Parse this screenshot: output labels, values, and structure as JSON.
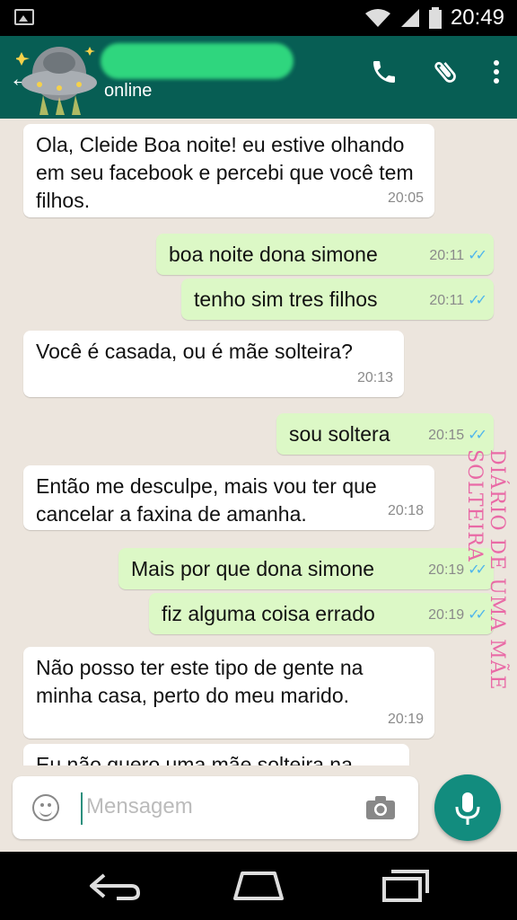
{
  "status_bar": {
    "time": "20:49"
  },
  "header": {
    "status": "online"
  },
  "messages": [
    {
      "text": "Ola, Cleide Boa noite! eu estive olhando em seu facebook e percebi que você  tem filhos.",
      "time": "20:05"
    },
    {
      "text": "boa noite dona simone",
      "time": "20:11"
    },
    {
      "text": "tenho sim tres filhos",
      "time": "20:11"
    },
    {
      "text": "Você é casada, ou é  mãe solteira?",
      "time": "20:13"
    },
    {
      "text": "sou soltera",
      "time": "20:15"
    },
    {
      "text": "Então me desculpe, mais vou ter que cancelar a faxina de amanha.",
      "time": "20:18"
    },
    {
      "text": "Mais por que dona simone",
      "time": "20:19"
    },
    {
      "text": "fiz alguma coisa errado",
      "time": "20:19"
    },
    {
      "text": "Não  posso ter este tipo de gente na minha casa, perto do meu marido.",
      "time": "20:19"
    },
    {
      "text": "Eu não quero uma mãe solteira na",
      "time": ""
    }
  ],
  "watermark": "DIÁRIO DE UMA MÃE SOLTEIRA",
  "input": {
    "placeholder": "Mensagem"
  },
  "icons": {
    "header": [
      "back-arrow-icon",
      "avatar",
      "phone-icon",
      "paperclip-icon",
      "more-vert-icon"
    ],
    "input": [
      "emoji-icon",
      "camera-icon",
      "mic-icon"
    ],
    "nav": [
      "back-nav-icon",
      "home-icon",
      "recents-icon"
    ]
  },
  "colors": {
    "header": "#075e54",
    "outgoing": "#dcf8c6",
    "incoming": "#ffffff",
    "chat_bg": "#ece5dd",
    "read_tick": "#4fb6ec",
    "mic": "#128c7e"
  }
}
